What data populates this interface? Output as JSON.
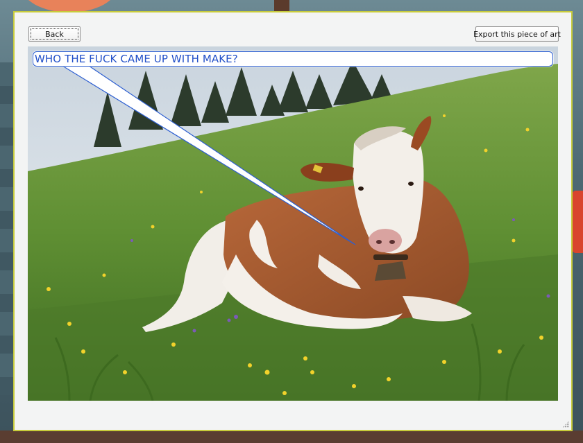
{
  "toolbar": {
    "back_label": "Back",
    "export_label": "Export this piece of art"
  },
  "artwork": {
    "speech_text": "WHO THE FUCK CAME UP WITH MAKE?",
    "bubble_color": "#2d5fd1",
    "text_color": "#2250c8"
  },
  "colors": {
    "window_border": "#c8cc3b",
    "window_bg": "#f3f4f4"
  }
}
